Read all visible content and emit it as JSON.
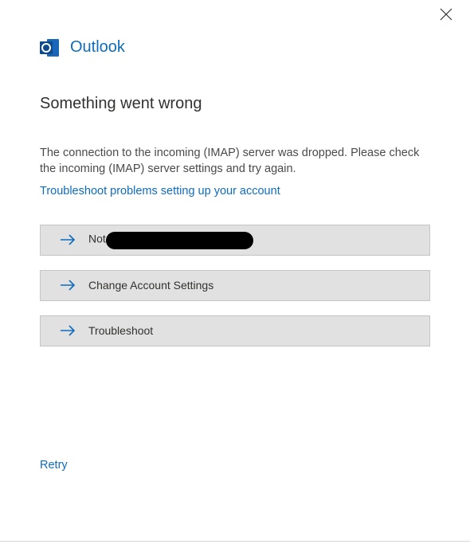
{
  "app": {
    "name": "Outlook"
  },
  "dialog": {
    "title": "Something went wrong",
    "message": "The connection to the incoming (IMAP) server was dropped. Please check the incoming (IMAP) server settings and try again.",
    "help_link": "Troubleshoot problems setting up your account"
  },
  "options": {
    "not_account_prefix": "Not ",
    "change_settings": "Change Account Settings",
    "troubleshoot": "Troubleshoot"
  },
  "actions": {
    "retry": "Retry"
  },
  "colors": {
    "accent": "#0f6cbd",
    "button_bg": "#e1e1e1",
    "text": "#323130"
  }
}
